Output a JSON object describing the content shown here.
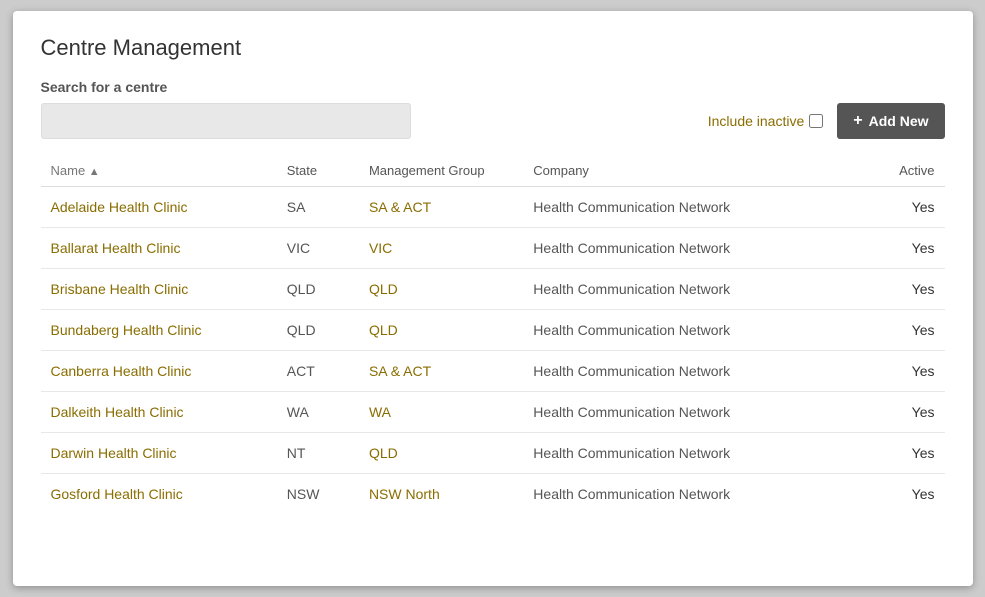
{
  "page": {
    "title": "Centre Management",
    "search": {
      "section_label": "Search for a centre",
      "input_placeholder": "",
      "include_inactive_label": "Include inactive",
      "add_new_label": "Add New"
    },
    "table": {
      "columns": [
        {
          "key": "name",
          "label": "Name",
          "sort": "asc"
        },
        {
          "key": "state",
          "label": "State"
        },
        {
          "key": "management_group",
          "label": "Management Group"
        },
        {
          "key": "company",
          "label": "Company"
        },
        {
          "key": "active",
          "label": "Active"
        }
      ],
      "rows": [
        {
          "name": "Adelaide Health Clinic",
          "state": "SA",
          "management_group": "SA & ACT",
          "company": "Health Communication Network",
          "active": "Yes"
        },
        {
          "name": "Ballarat Health Clinic",
          "state": "VIC",
          "management_group": "VIC",
          "company": "Health Communication Network",
          "active": "Yes"
        },
        {
          "name": "Brisbane Health Clinic",
          "state": "QLD",
          "management_group": "QLD",
          "company": "Health Communication Network",
          "active": "Yes"
        },
        {
          "name": "Bundaberg Health Clinic",
          "state": "QLD",
          "management_group": "QLD",
          "company": "Health Communication Network",
          "active": "Yes"
        },
        {
          "name": "Canberra Health Clinic",
          "state": "ACT",
          "management_group": "SA & ACT",
          "company": "Health Communication Network",
          "active": "Yes"
        },
        {
          "name": "Dalkeith Health Clinic",
          "state": "WA",
          "management_group": "WA",
          "company": "Health Communication Network",
          "active": "Yes"
        },
        {
          "name": "Darwin Health Clinic",
          "state": "NT",
          "management_group": "QLD",
          "company": "Health Communication Network",
          "active": "Yes"
        },
        {
          "name": "Gosford Health Clinic",
          "state": "NSW",
          "management_group": "NSW North",
          "company": "Health Communication Network",
          "active": "Yes"
        }
      ]
    }
  }
}
